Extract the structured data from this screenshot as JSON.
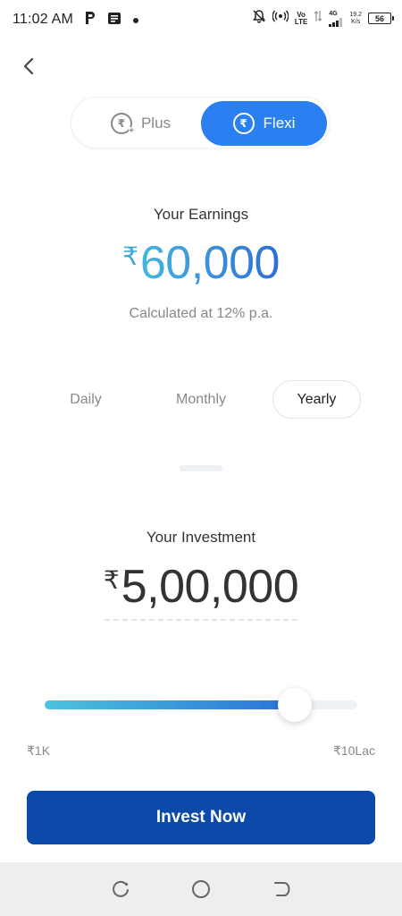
{
  "status_bar": {
    "time": "11:02 AM",
    "network_top": "Vo",
    "network_bottom": "LTE",
    "signal_type": "4G",
    "speed_value": "19.2",
    "speed_unit": "K/s",
    "battery": "56",
    "icons": [
      "p-icon",
      "message-icon",
      "dot-icon",
      "bell-off-icon",
      "hotspot-icon",
      "data-arrows-icon",
      "signal-icon",
      "battery-icon"
    ]
  },
  "plan_toggle": {
    "options": [
      {
        "label": "Plus",
        "icon": "rupee-plus-icon",
        "selected": false
      },
      {
        "label": "Flexi",
        "icon": "rupee-icon",
        "selected": true
      }
    ]
  },
  "earnings": {
    "label": "Your Earnings",
    "currency": "₹",
    "amount": "60,000",
    "note": "Calculated at 12% p.a."
  },
  "period_tabs": [
    {
      "label": "Daily",
      "selected": false
    },
    {
      "label": "Monthly",
      "selected": false
    },
    {
      "label": "Yearly",
      "selected": true
    }
  ],
  "investment": {
    "label": "Your Investment",
    "currency": "₹",
    "amount": "5,00,000"
  },
  "slider": {
    "min_label": "₹1K",
    "max_label": "₹10Lac",
    "value_fraction": 0.8
  },
  "cta": {
    "label": "Invest Now"
  },
  "colors": {
    "accent": "#2a80f0",
    "cta": "#0b4aa8",
    "gradient_start": "#45b5e0",
    "gradient_end": "#2e6ed3"
  }
}
